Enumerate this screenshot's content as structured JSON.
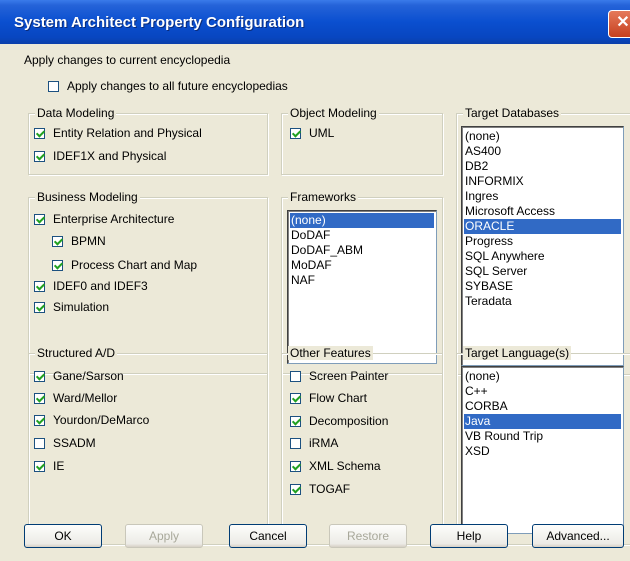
{
  "window": {
    "title": "System Architect Property Configuration",
    "close_glyph": "✕"
  },
  "apply_current": "Apply changes to current encyclopedia",
  "apply_future": {
    "label": "Apply changes to all future encyclopedias",
    "checked": false
  },
  "data_modeling": {
    "title": "Data Modeling",
    "items": [
      {
        "label": "Entity Relation and Physical",
        "checked": true
      },
      {
        "label": "IDEF1X and Physical",
        "checked": true
      }
    ]
  },
  "object_modeling": {
    "title": "Object Modeling",
    "items": [
      {
        "label": "UML",
        "checked": true
      }
    ]
  },
  "business_modeling": {
    "title": "Business Modeling",
    "items": [
      {
        "label": "Enterprise Architecture",
        "checked": true
      },
      {
        "label": "BPMN",
        "checked": true
      },
      {
        "label": "Process Chart and Map",
        "checked": true
      },
      {
        "label": "IDEF0 and IDEF3",
        "checked": true
      },
      {
        "label": "Simulation",
        "checked": true
      }
    ]
  },
  "frameworks": {
    "title": "Frameworks",
    "items": [
      "(none)",
      "DoDAF",
      "DoDAF_ABM",
      "MoDAF",
      "NAF"
    ],
    "selected": "(none)"
  },
  "target_databases": {
    "title": "Target Databases",
    "items": [
      "(none)",
      "AS400",
      "DB2",
      "INFORMIX",
      "Ingres",
      "Microsoft Access",
      "ORACLE",
      "Progress",
      "SQL Anywhere",
      "SQL Server",
      "SYBASE",
      "Teradata"
    ],
    "selected": "ORACLE"
  },
  "structured_ad": {
    "title": "Structured A/D",
    "items": [
      {
        "label": "Gane/Sarson",
        "checked": true
      },
      {
        "label": "Ward/Mellor",
        "checked": true
      },
      {
        "label": "Yourdon/DeMarco",
        "checked": true
      },
      {
        "label": "SSADM",
        "checked": false
      },
      {
        "label": "IE",
        "checked": true
      }
    ]
  },
  "other_features": {
    "title": "Other Features",
    "items": [
      {
        "label": "Screen Painter",
        "checked": false
      },
      {
        "label": "Flow Chart",
        "checked": true
      },
      {
        "label": "Decomposition",
        "checked": true
      },
      {
        "label": "iRMA",
        "checked": false
      },
      {
        "label": "XML Schema",
        "checked": true
      },
      {
        "label": "TOGAF",
        "checked": true
      }
    ]
  },
  "target_languages": {
    "title": "Target Language(s)",
    "items": [
      "(none)",
      "C++",
      "CORBA",
      "Java",
      "VB Round Trip",
      "XSD"
    ],
    "selected": "Java"
  },
  "buttons": {
    "ok": "OK",
    "apply": "Apply",
    "cancel": "Cancel",
    "restore": "Restore",
    "help": "Help",
    "advanced": "Advanced..."
  }
}
